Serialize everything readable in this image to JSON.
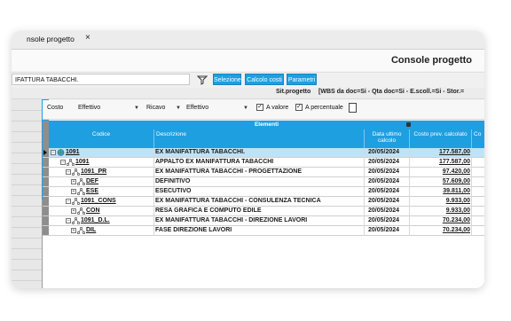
{
  "tab": {
    "label": "nsole progetto",
    "close": "×"
  },
  "header": {
    "title": "Console progetto"
  },
  "toolbar": {
    "project_value": "IFATTURA TABACCHI.",
    "buttons": {
      "selezione": "Selezione",
      "calcolo": "Calcolo costi",
      "parametri": "Parametri"
    }
  },
  "status": {
    "label": "Sit.progetto",
    "value": "[WBS da doc=Si - Qta doc=Si - E.scoll.=Si - Stor.="
  },
  "options": {
    "costo_label": "Costo",
    "costo_value": "Effettivo",
    "ricavo_label": "Ricavo",
    "ricavo_value": "Effettivo",
    "a_valore": "A valore",
    "a_percentuale": "A percentuale"
  },
  "grid": {
    "group_header": "Elementi",
    "columns": {
      "codice": "Codice",
      "descrizione": "Descrizione",
      "data": "Data ultimo calcolo",
      "costo": "Costo prev. calcolato",
      "more": "Co"
    },
    "rows": [
      {
        "code": "1091",
        "desc": "EX MANIFATTURA TABACCHI.",
        "date": "20/05/2024",
        "cost": "177.587,00"
      },
      {
        "code": "1091",
        "desc": "APPALTO EX MANIFATTURA TABACCHI",
        "date": "20/05/2024",
        "cost": "177.587,00"
      },
      {
        "code": "1091_PR",
        "desc": "EX MANIFATTURA TABACCHI - PROGETTAZIONE",
        "date": "20/05/2024",
        "cost": "97.420,00"
      },
      {
        "code": "DEF",
        "desc": "DEFINITIVO",
        "date": "20/05/2024",
        "cost": "57.609,00"
      },
      {
        "code": "ESE",
        "desc": "ESECUTIVO",
        "date": "20/05/2024",
        "cost": "39.811,00"
      },
      {
        "code": "1091_CONS",
        "desc": "EX MANIFATTURA TABACCHI - CONSULENZA TECNICA",
        "date": "20/05/2024",
        "cost": "9.933,00"
      },
      {
        "code": "CON",
        "desc": "RESA GRAFICA E COMPUTO EDILE",
        "date": "20/05/2024",
        "cost": "9.933,00"
      },
      {
        "code": "1091_D.L.",
        "desc": "EX MANIFATTURA TABACCHI - DIREZIONE LAVORI",
        "date": "20/05/2024",
        "cost": "70.234,00"
      },
      {
        "code": "DIL",
        "desc": "FASE DIREZIONE LAVORI",
        "date": "20/05/2024",
        "cost": "70.234,00"
      }
    ]
  },
  "colors": {
    "accent": "#1e9fe0",
    "selected_row": "#bfe3f6"
  },
  "icons": [
    "close-icon",
    "filter-icon",
    "calculator-icon",
    "lock-icon",
    "globe-icon",
    "tree-node-icon",
    "expand-icon",
    "row-pointer-icon"
  ]
}
